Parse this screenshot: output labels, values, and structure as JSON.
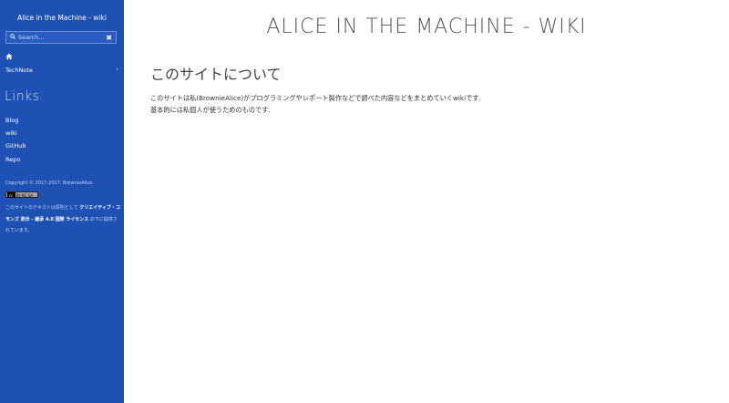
{
  "sidebar": {
    "site_title": "Alice in the Machine - wiki",
    "search": {
      "placeholder": "Search...",
      "clear_label": "✖"
    },
    "nav": {
      "home_icon": "home-icon",
      "technote_label": "TechNote",
      "chevron": "›"
    },
    "links_heading": "Links",
    "links": [
      "Blog",
      "wiki",
      "GitHub",
      "Repo"
    ],
    "copyright": "Copyright © 2017-2017, BrownieAlice.",
    "badge_label": "BY-NC-SA",
    "license": {
      "prefix": "このサイトのテキストは原則として ",
      "link": "クリエイティブ・コモンズ 表示 - 継承 4.0 国際 ライセンス",
      "suffix": " の下に提供されています。"
    }
  },
  "main": {
    "page_title": "Alice in the Machine - wiki",
    "heading": "このサイトについて",
    "paragraph_line1": "このサイトは私(BrownieAlice)がプログラミングやレポート製作などで調べた内容などをまとめていくwikiです.",
    "paragraph_line2": "基本的には私個人が使うためのものです."
  },
  "colors": {
    "sidebar_bg": "#1f51b5",
    "main_bg": "#ffffff",
    "title_text": "#555555"
  }
}
